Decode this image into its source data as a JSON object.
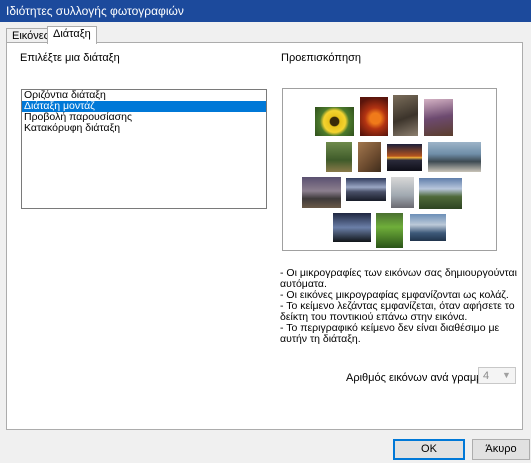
{
  "window": {
    "title": "Ιδιότητες συλλογής φωτογραφιών"
  },
  "tabs": [
    {
      "label": "Εικόνες",
      "active": false
    },
    {
      "label": "Διάταξη",
      "active": true
    }
  ],
  "layout": {
    "choose_label": "Επιλέξτε μια διάταξη",
    "options": [
      "Οριζόντια διάταξη",
      "Διάταξη μοντάζ",
      "Προβολή παρουσίασης",
      "Κατακόρυφη διάταξη"
    ],
    "selected": "Διάταξη μοντάζ"
  },
  "preview": {
    "label": "Προεπισκόπηση",
    "thumbnails": [
      "sunflower",
      "red-autumn",
      "railway-track",
      "flower-bush",
      "mountain-stream",
      "rock-wall",
      "sunset-sea",
      "sea-rocks",
      "ruins-landscape",
      "stormy-pier",
      "bird-on-wire",
      "green-hills",
      "tree-silhouette",
      "green-grass",
      "waterfall-lake"
    ]
  },
  "notes": [
    "- Οι μικρογραφίες των εικόνων σας δημιουργούνται αυτόματα.",
    "- Οι εικόνες μικρογραφίας εμφανίζονται ως κολάζ.",
    "- Το κείμενο λεζάντας εμφανίζεται, όταν αφήσετε το δείκτη του ποντικιού επάνω στην εικόνα.",
    "- Το περιγραφικό κείμενο δεν είναι διαθέσιμο με αυτήν τη διάταξη."
  ],
  "per_row": {
    "label": "Αριθμός εικόνων ανά γραμμή:",
    "value": "4",
    "enabled": false
  },
  "buttons": {
    "ok": "OK",
    "cancel": "Άκυρο"
  },
  "colors": {
    "titlebar": "#1c4a9c",
    "selection": "#0078d7"
  }
}
